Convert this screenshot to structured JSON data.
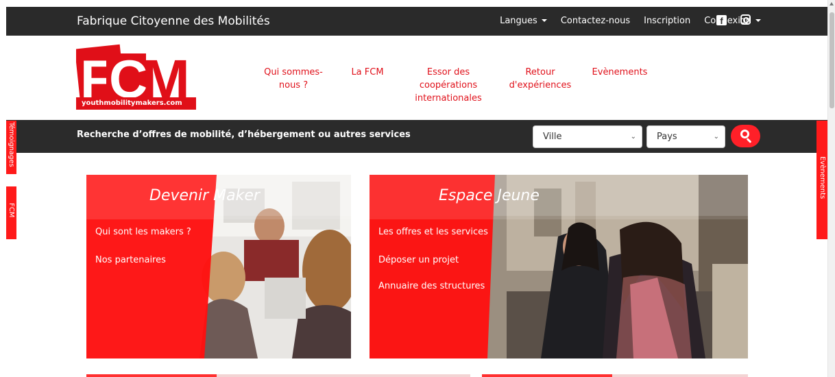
{
  "top_bar": {
    "site_title": "Fabrique Citoyenne des Mobilités",
    "nav": {
      "languages": "Langues",
      "contact": "Contactez-nous",
      "register": "Inscription",
      "login": "Connexion"
    },
    "social": [
      "facebook-icon",
      "instagram-icon"
    ]
  },
  "logo": {
    "letters": "FCM",
    "url_prefix": "youthmobility",
    "url_suffix": "makers.com"
  },
  "main_nav": {
    "items": [
      {
        "line1": "Qui sommes-",
        "line2": "nous ?",
        "line3": ""
      },
      {
        "line1": "La FCM",
        "line2": "",
        "line3": ""
      },
      {
        "line1": "Essor des",
        "line2": "coopérations",
        "line3": "internationales"
      },
      {
        "line1": "Retour",
        "line2": "d'expériences",
        "line3": ""
      },
      {
        "line1": "Evènements",
        "line2": "",
        "line3": ""
      }
    ]
  },
  "search": {
    "label": "Recherche d’offres de mobilité, d’hébergement ou autres services",
    "city_selected": "Ville",
    "country_selected": "Pays"
  },
  "side_tabs": {
    "left_testimonials": "Témoignages",
    "left_fcm": "FCM",
    "right_events": "Evènements"
  },
  "cards": {
    "maker": {
      "title_a": "Devenir",
      "title_b": "Maker",
      "links": [
        "Qui sont les makers ?",
        "Nos partenaires"
      ]
    },
    "youth": {
      "title_a": "Espace",
      "title_b": "Jeune",
      "links": [
        "Les offres et les services",
        "Déposer un projet",
        "Annuaire des structures"
      ]
    }
  },
  "colors": {
    "brand_red": "#e0101a",
    "dark_bar": "#2a2a2a",
    "button_red": "#ff2028"
  }
}
